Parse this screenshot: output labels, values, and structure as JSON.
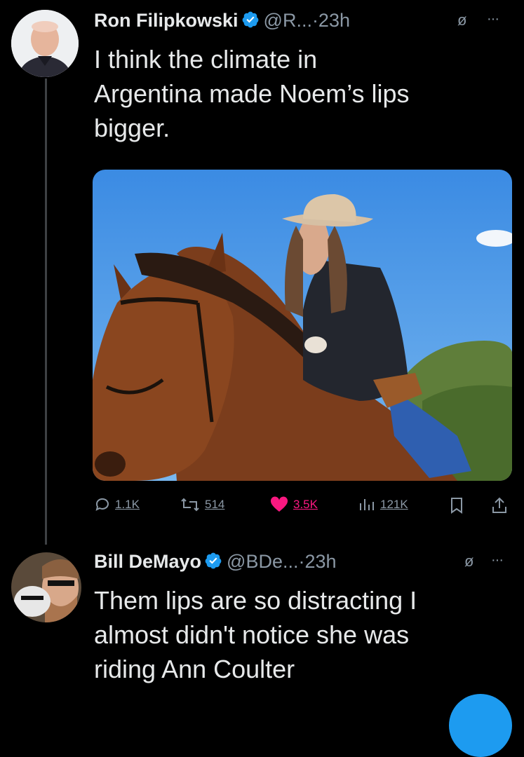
{
  "tweet1": {
    "author_name": "Ron Filipkowski",
    "handle_time": "@R...·23h",
    "text_lines": [
      "I think the climate in",
      "Argentina made Noem’s lips",
      "bigger."
    ],
    "actions": {
      "replies": "1.1K",
      "retweets": "514",
      "likes": "3.5K",
      "views": "121K"
    }
  },
  "tweet2": {
    "author_name": "Bill DeMayo",
    "handle_time": "@BDe...·23h",
    "text_lines": [
      "Them lips are so distracting I",
      "almost didn't notice she was",
      "riding Ann Coulter"
    ]
  },
  "icons": {
    "verified": "verified-badge-icon",
    "muted": "muted-icon",
    "more": "more-icon",
    "reply": "reply-icon",
    "retweet": "retweet-icon",
    "like": "heart-icon",
    "views": "views-icon",
    "bookmark": "bookmark-icon",
    "share": "share-icon"
  },
  "colors": {
    "background": "#000000",
    "text": "#e7e9ea",
    "secondary": "#8b98a5",
    "verified": "#1d9bf0",
    "like": "#f91880"
  }
}
